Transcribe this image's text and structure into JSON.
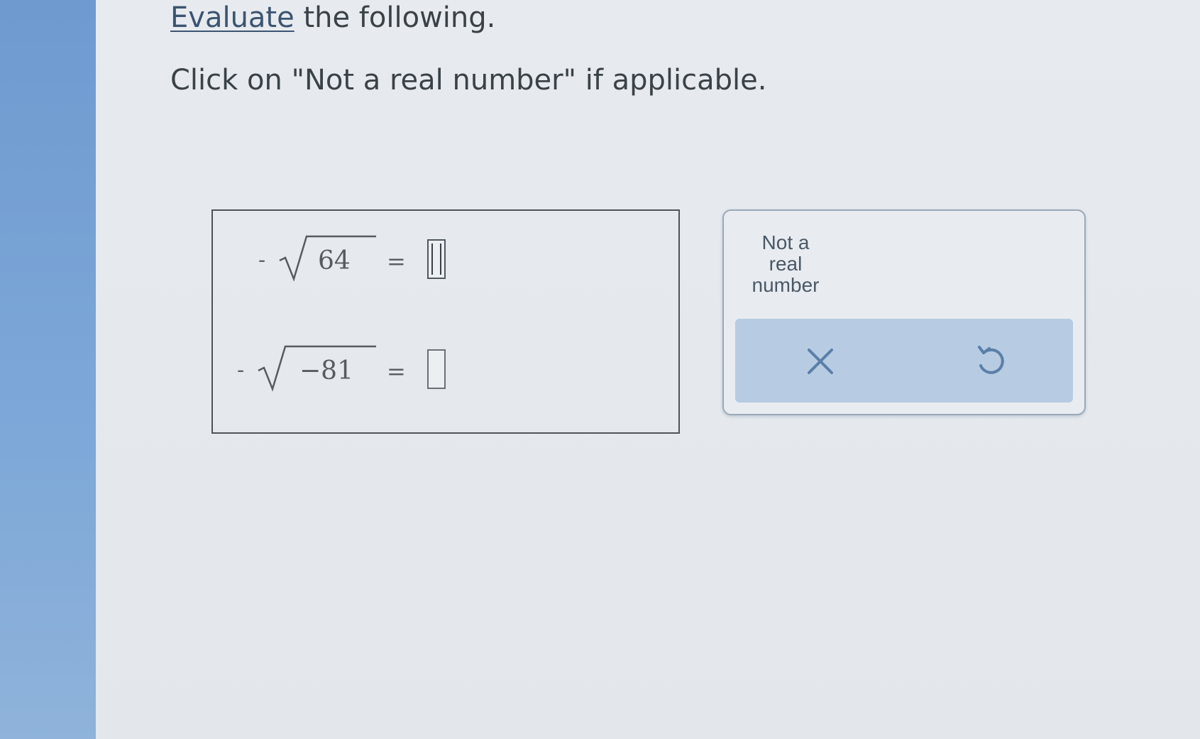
{
  "instructions": {
    "line1_link": "Evaluate",
    "line1_rest": " the following.",
    "line2": "Click on \"Not a real number\" if applicable."
  },
  "problems": [
    {
      "sign": "-",
      "radicand": "64",
      "equals": "=",
      "answer": ""
    },
    {
      "sign": "-",
      "radicand": "−81",
      "equals": "=",
      "answer": ""
    }
  ],
  "keypad": {
    "not_real_line1": "Not a",
    "not_real_line2": "real",
    "not_real_line3": "number",
    "clear_icon": "x-icon",
    "undo_icon": "undo-icon"
  },
  "colors": {
    "sidebar": "#7ea8d8",
    "action_bar": "#b7cbe2",
    "icon": "#5a7fa8"
  }
}
